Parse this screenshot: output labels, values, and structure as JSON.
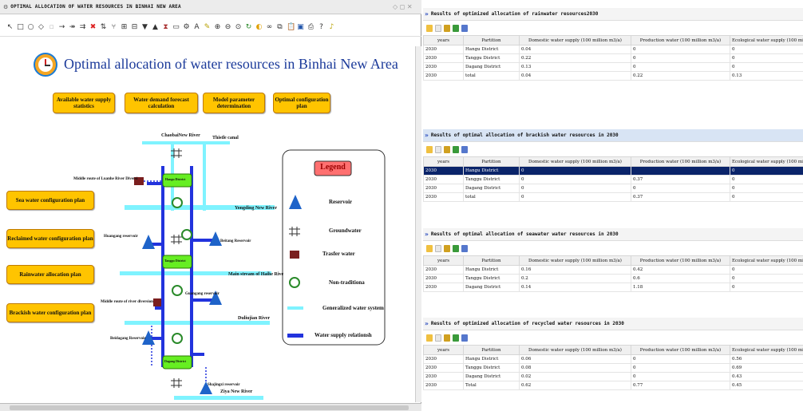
{
  "window": {
    "title": "OPTIMAL ALLOCATION OF WATER RESOURCES IN BINHAI NEW AREA"
  },
  "main": {
    "heading": "Optimal allocation of water resources in Binhai New Area",
    "top_buttons": [
      "Available water supply statistics",
      "Water demand forecast calculation",
      "Model parameter determination",
      "Optimal configuration plan"
    ],
    "side_buttons": [
      "Sea water configuration plan",
      "Reclaimed water configuration plan",
      "Rainwater allocation plan",
      "Brackish water configuration plan"
    ]
  },
  "diagram": {
    "rivers": [
      "ChaobaiNew River",
      "Thistle canal",
      "Yongding New River",
      "Main stream of Haihe Rive",
      "Duliujian River",
      "Ziya New River"
    ],
    "nodes": [
      "Hangu District",
      "Tanggu District",
      "Dagang District"
    ],
    "reservoirs": [
      "Huangang reservoir",
      "Beitang Reservoir",
      "Guangang reservoir",
      "Beidagang Reservoir",
      "Shajingzi reservoir"
    ],
    "transfers": [
      "Middle route of Luanhe River Diversi",
      "Middle route of river diversion"
    ],
    "legend": {
      "title": "Legend",
      "items": [
        "Reservoir",
        "Groundwater",
        "Trasfer water",
        "Non-traditiona",
        "Generalized water system",
        "Water supply relationsh"
      ]
    }
  },
  "results": [
    {
      "title": "Results of optimized allocation of rainwater resources2030",
      "columns": [
        "years",
        "Partition",
        "Domestic water supply (100 million m3/a)",
        "Production water (100 million m3/a)",
        "Ecological water supply (100 mi"
      ],
      "rows": [
        [
          "2030",
          "Hangu District",
          "0.04",
          "0",
          "0"
        ],
        [
          "2030",
          "Tanggu District",
          "0.22",
          "0",
          "0"
        ],
        [
          "2030",
          "Dagang District",
          "0.13",
          "0",
          "0"
        ],
        [
          "2030",
          "total",
          "0.04",
          "0.22",
          "0.13"
        ]
      ]
    },
    {
      "title": "Results of optimal allocation of brackish water resources in 2030",
      "columns": [
        "years",
        "Partition",
        "Domestic water supply (100 million m3/a)",
        "Production water (100 million m3/a)",
        "Ecological water supply (100 mill"
      ],
      "rows": [
        [
          "2030",
          "Hangu District",
          "0",
          "",
          "0"
        ],
        [
          "2030",
          "Tanggu District",
          "0",
          "0.37",
          "0"
        ],
        [
          "2030",
          "Dagang District",
          "0",
          "0",
          "0"
        ],
        [
          "2030",
          "total",
          "0",
          "0.37",
          "0"
        ]
      ]
    },
    {
      "title": "Results of optimal allocation of seawater water resources in 2030",
      "columns": [
        "years",
        "Partition",
        "Domestic water supply (100 million m3/a)",
        "Production water (100 million m3/a)",
        "Ecological water supply (100 mill"
      ],
      "rows": [
        [
          "2030",
          "Hangu District",
          "0.16",
          "0.42",
          "0"
        ],
        [
          "2030",
          "Tanggu District",
          "0.2",
          "0.6",
          "0"
        ],
        [
          "2030",
          "Dagang District",
          "0.14",
          "1.18",
          "0"
        ]
      ]
    },
    {
      "title": "Results of optimized allocation of recycled water resources in 2030",
      "columns": [
        "years",
        "Partition",
        "Domestic water supply (100 million m3/a)",
        "Production water (100 million m3/a)",
        "Ecological water supply (100 mill"
      ],
      "rows": [
        [
          "2030",
          "Hangu District",
          "0.06",
          "0",
          "0.56"
        ],
        [
          "2030",
          "Tanggu District",
          "0.08",
          "0",
          "0.69"
        ],
        [
          "2030",
          "Dagang District",
          "0.02",
          "0",
          "0.43"
        ],
        [
          "2030",
          "Total",
          "0.62",
          "0.77",
          "0.45"
        ]
      ]
    }
  ],
  "colors": {
    "accent_button": "#ffc400",
    "node": "#66ee22",
    "river": "#7ff3ff",
    "supply": "#2233dd",
    "reservoir": "#1e63c9",
    "selection": "#0a246a"
  }
}
